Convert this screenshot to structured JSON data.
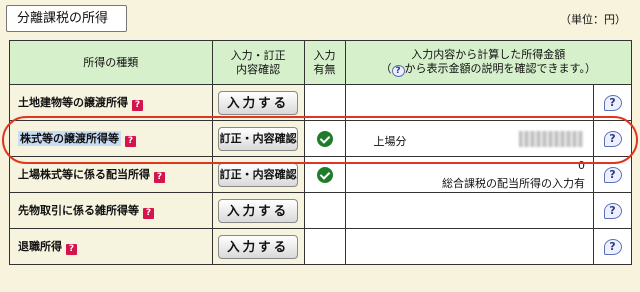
{
  "page": {
    "title": "分離課税の所得",
    "unit_note": "（単位：円）"
  },
  "table": {
    "headers": {
      "type": "所得の種類",
      "input_line1": "入力・訂正",
      "input_line2": "内容確認",
      "entered_line1": "入力",
      "entered_line2": "有無",
      "amount_line1": "入力内容から計算した所得金額",
      "amount_line2_pre": "（",
      "amount_line2_icon": "?",
      "amount_line2_post": "から表示金額の説明を確認できます。）"
    },
    "rows": [
      {
        "name": "土地建物等の譲渡所得",
        "badge": "?",
        "button": "入力する",
        "entered": false,
        "amount_label": "",
        "amount_value": "",
        "amount_note": ""
      },
      {
        "name": "株式等の譲渡所得等",
        "badge": "?",
        "button": "訂正・内容確認",
        "entered": true,
        "amount_label": "上場分",
        "amount_value": "",
        "amount_note": ""
      },
      {
        "name": "上場株式等に係る配当所得",
        "badge": "?",
        "button": "訂正・内容確認",
        "entered": true,
        "amount_label": "",
        "amount_value": "0",
        "amount_note": "総合課税の配当所得の入力有"
      },
      {
        "name": "先物取引に係る雑所得等",
        "badge": "?",
        "button": "入力する",
        "entered": false,
        "amount_label": "",
        "amount_value": "",
        "amount_note": ""
      },
      {
        "name": "退職所得",
        "badge": "?",
        "button": "入力する",
        "entered": false,
        "amount_label": "",
        "amount_value": "",
        "amount_note": ""
      }
    ],
    "help_icon": "?"
  },
  "colors": {
    "background": "#f7f3dc",
    "header_green": "#d6f0cc",
    "badge_red": "#d4144d",
    "check_green": "#1f7d29",
    "highlight_ellipse": "#e0361f"
  }
}
